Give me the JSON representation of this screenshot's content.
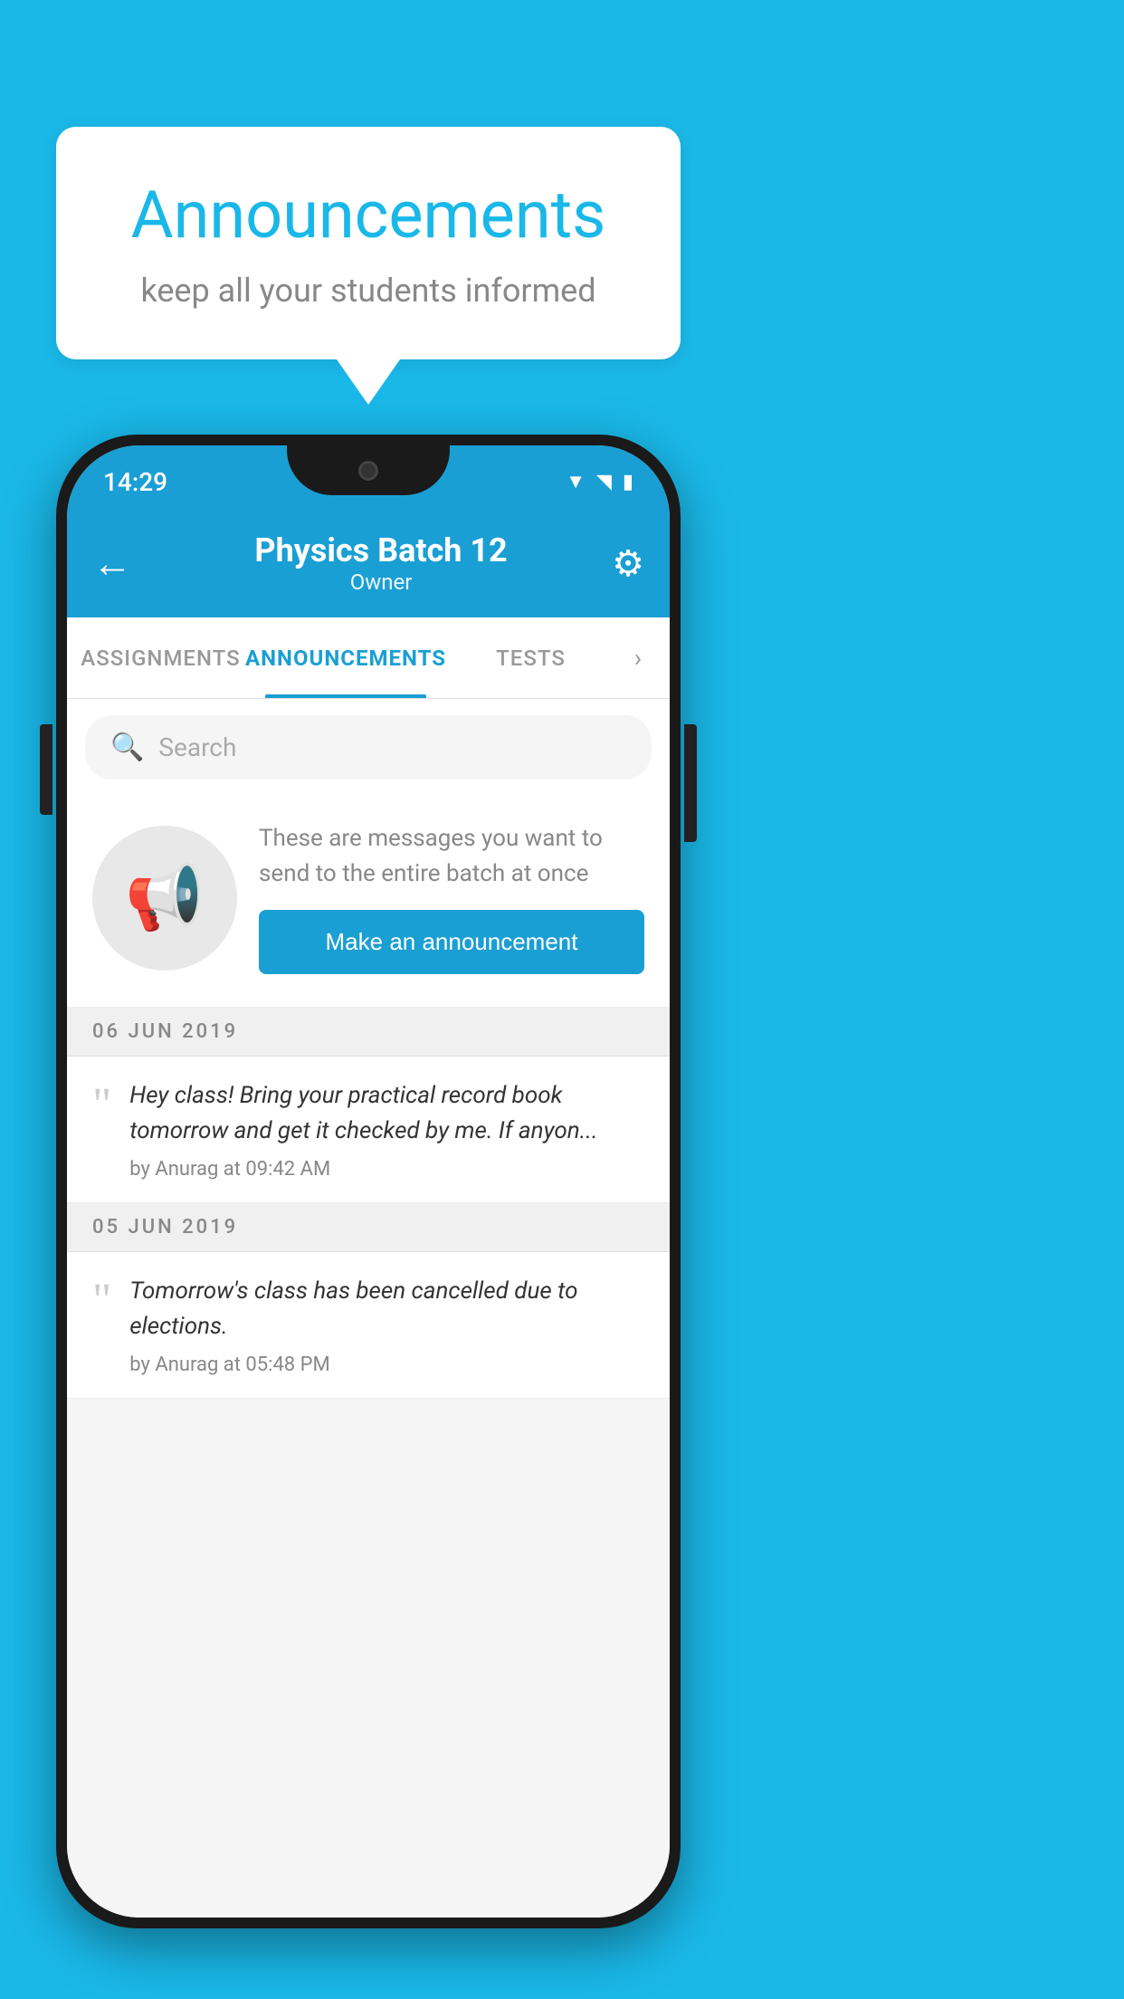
{
  "background_color": "#1ab8e8",
  "speech_bubble": {
    "title": "Announcements",
    "subtitle": "keep all your students informed"
  },
  "phone": {
    "status_bar": {
      "time": "14:29",
      "icons": [
        "wifi",
        "signal",
        "battery"
      ]
    },
    "app_bar": {
      "title": "Physics Batch 12",
      "subtitle": "Owner",
      "back_label": "←",
      "settings_label": "⚙"
    },
    "tabs": [
      {
        "label": "ASSIGNMENTS",
        "active": false
      },
      {
        "label": "ANNOUNCEMENTS",
        "active": true
      },
      {
        "label": "TESTS",
        "active": false
      }
    ],
    "search": {
      "placeholder": "Search"
    },
    "promo": {
      "description": "These are messages you want to send to the entire batch at once",
      "button_label": "Make an announcement"
    },
    "announcements": [
      {
        "date": "06  JUN  2019",
        "text": "Hey class! Bring your practical record book tomorrow and get it checked by me. If anyon...",
        "meta": "by Anurag at 09:42 AM"
      },
      {
        "date": "05  JUN  2019",
        "text": "Tomorrow's class has been cancelled due to elections.",
        "meta": "by Anurag at 05:48 PM"
      }
    ]
  }
}
